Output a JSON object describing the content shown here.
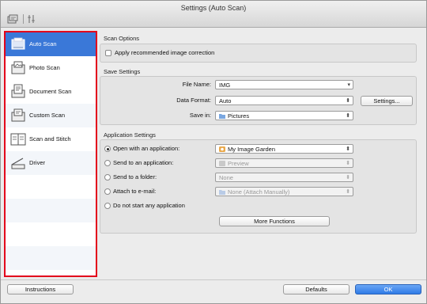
{
  "window": {
    "title": "Settings (Auto Scan)"
  },
  "toolbar": {
    "icons": [
      "scan-settings-icon",
      "general-settings-icon"
    ]
  },
  "sidebar": {
    "items": [
      {
        "label": "Auto Scan",
        "icon": "auto-scan-icon",
        "selected": true
      },
      {
        "label": "Photo Scan",
        "icon": "photo-scan-icon",
        "selected": false
      },
      {
        "label": "Document Scan",
        "icon": "document-scan-icon",
        "selected": false
      },
      {
        "label": "Custom Scan",
        "icon": "custom-scan-icon",
        "selected": false
      },
      {
        "label": "Scan and Stitch",
        "icon": "scan-stitch-icon",
        "selected": false
      },
      {
        "label": "Driver",
        "icon": "driver-icon",
        "selected": false
      }
    ],
    "highlight_color": "#e3001b",
    "selected_color": "#3a78d8"
  },
  "scan_options": {
    "title": "Scan Options",
    "apply_correction_label": "Apply recommended image correction",
    "apply_correction_checked": false
  },
  "save_settings": {
    "title": "Save Settings",
    "file_name_label": "File Name:",
    "file_name_value": "IMG",
    "data_format_label": "Data Format:",
    "data_format_value": "Auto",
    "settings_button": "Settings...",
    "save_in_label": "Save in:",
    "save_in_value": "Pictures"
  },
  "application_settings": {
    "title": "Application Settings",
    "open_app_label": "Open with an application:",
    "open_app_value": "My Image Garden",
    "send_app_label": "Send to an application:",
    "send_app_value": "Preview",
    "send_folder_label": "Send to a folder:",
    "send_folder_value": "None",
    "attach_email_label": "Attach to e-mail:",
    "attach_email_value": "None (Attach Manually)",
    "no_app_label": "Do not start any application",
    "selected_option": "Open with an application:",
    "more_functions_button": "More Functions"
  },
  "footer": {
    "instructions_button": "Instructions",
    "defaults_button": "Defaults",
    "ok_button": "OK"
  }
}
